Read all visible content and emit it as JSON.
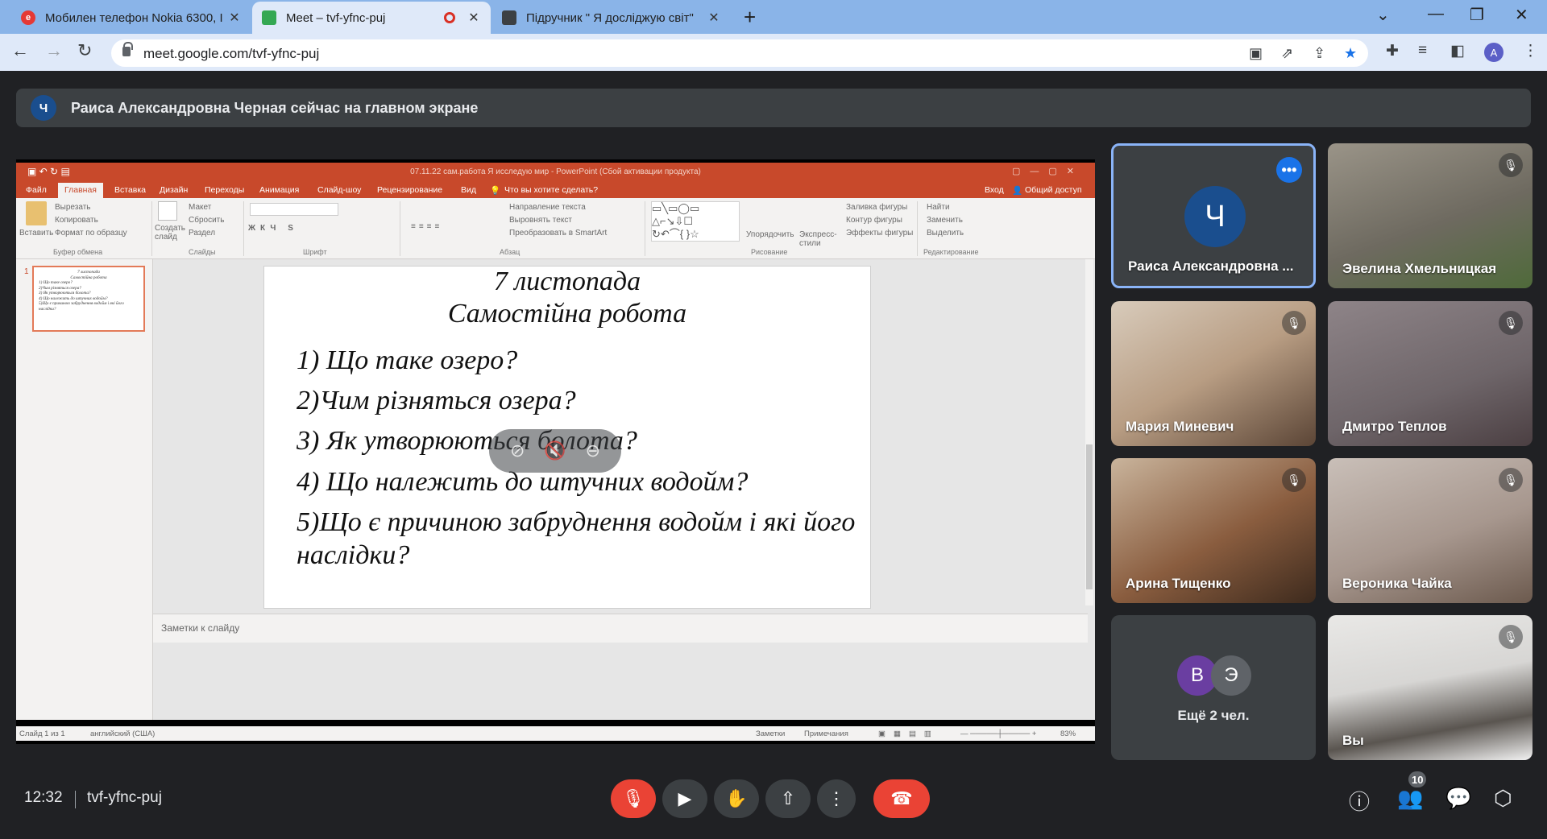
{
  "browser": {
    "tabs": [
      {
        "title": "Мобилен телефон Nokia 6300, Ӏ",
        "favicon_color": "#e53935"
      },
      {
        "title": "Meet – tvf-yfnc-puj",
        "favicon_color": "#34a853"
      },
      {
        "title": "Підручник \" Я досліджую світ\"  ",
        "favicon_color": "#3c4043"
      }
    ],
    "url": "meet.google.com/tvf-yfnc-puj",
    "profile_initial": "A"
  },
  "banner": {
    "avatar_letter": "Ч",
    "message": "Раиса Александровна Черная сейчас на главном экране"
  },
  "powerpoint": {
    "window_title": "07.11.22 сам.работа Я исследую мир - PowerPoint (Сбой активации продукта)",
    "ribbon_tabs": [
      "Файл",
      "Главная",
      "Вставка",
      "Дизайн",
      "Переходы",
      "Анимация",
      "Слайд-шоу",
      "Рецензирование",
      "Вид"
    ],
    "tell_me": "Что вы хотите сделать?",
    "sign_in": "Вход",
    "share": "Общий доступ",
    "clipboard": {
      "paste": "Вставить",
      "cut": "Вырезать",
      "copy": "Копировать",
      "format": "Формат по образцу",
      "group": "Буфер обмена"
    },
    "slides": {
      "create": "Создать слайд",
      "layout": "Макет",
      "reset": "Сбросить",
      "section": "Раздел",
      "group": "Слайды"
    },
    "font_group": "Шрифт",
    "paragraph": {
      "text_dir": "Направление текста",
      "align": "Выровнять текст",
      "smartart": "Преобразовать в SmartArt",
      "group": "Абзац"
    },
    "drawing": {
      "arrange": "Упорядочить",
      "quick_styles": "Экспресс-стили",
      "fill": "Заливка фигуры",
      "outline": "Контур фигуры",
      "effects": "Эффекты фигуры",
      "group": "Рисование"
    },
    "editing": {
      "find": "Найти",
      "replace": "Заменить",
      "select": "Выделить",
      "group": "Редактирование"
    },
    "slide_number": "1",
    "slide": {
      "title_line1": "7 листопада",
      "title_line2": "Самостійна робота",
      "questions": [
        "1) Що таке озеро?",
        "2)Чим різняться озера?",
        "3) Як утворюються болота?",
        "4) Що належить до штучних водойм?",
        "5)Що є причиною забруднення водойм і які його",
        "наслідки?"
      ]
    },
    "notes_placeholder": "Заметки к слайду",
    "status": {
      "slide_count": "Слайд 1 из 1",
      "language": "английский (США)",
      "notes": "Заметки",
      "comments": "Примечания",
      "zoom": "83%"
    }
  },
  "participants": {
    "presenter": {
      "name": "Раиса Александровна ...",
      "avatar_letter": "Ч"
    },
    "tiles": [
      {
        "name": "Эвелина Хмельницкая",
        "bg": "#7a7468"
      },
      {
        "name": "Мария Миневич",
        "bg": "#b89d83"
      },
      {
        "name": "Дмитро Теплов",
        "bg": "#6e6569"
      },
      {
        "name": "Арина Тищенко",
        "bg": "#8a5d3f"
      },
      {
        "name": "Вероника Чайка",
        "bg": "#a7978e"
      },
      {
        "name": "Вы",
        "bg": "#d7d6d4"
      }
    ],
    "more": {
      "label": "Ещё 2 чел.",
      "avatars": [
        {
          "letter": "В",
          "color": "#6a3ea1"
        },
        {
          "letter": "Э",
          "color": "#5f6368"
        }
      ]
    }
  },
  "meeting": {
    "time": "12:32",
    "code": "tvf-yfnc-puj",
    "participants_count": "10"
  }
}
